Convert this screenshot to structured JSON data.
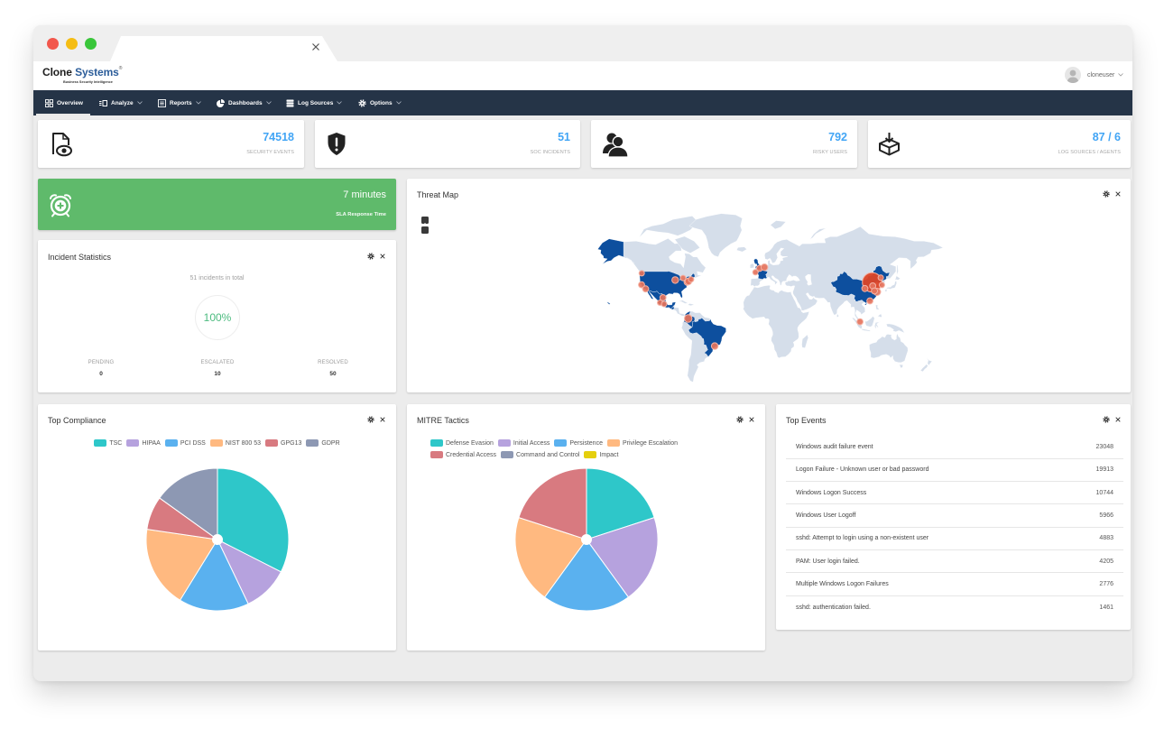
{
  "header": {
    "logo": {
      "part1": "Clone",
      "part2": "Systems",
      "registered": "®",
      "tagline": "Business Security Intelligence"
    },
    "user": {
      "name": "cloneuser"
    }
  },
  "nav": {
    "items": [
      {
        "label": "Overview",
        "icon": "grid-icon",
        "active": true,
        "dropdown": false
      },
      {
        "label": "Analyze",
        "icon": "analyze-icon",
        "active": false,
        "dropdown": true
      },
      {
        "label": "Reports",
        "icon": "report-icon",
        "active": false,
        "dropdown": true
      },
      {
        "label": "Dashboards",
        "icon": "pie-chart-icon",
        "active": false,
        "dropdown": true
      },
      {
        "label": "Log Sources",
        "icon": "database-icon",
        "active": false,
        "dropdown": true
      },
      {
        "label": "Options",
        "icon": "gear-icon",
        "active": false,
        "dropdown": true
      }
    ]
  },
  "stats": [
    {
      "value": "74518",
      "label": "SECURITY EVENTS",
      "icon": "document-eye-icon"
    },
    {
      "value": "51",
      "label": "SOC INCIDENTS",
      "icon": "shield-alert-icon"
    },
    {
      "value": "792",
      "label": "RISKY USERS",
      "icon": "users-icon"
    },
    {
      "value": "87 / 6",
      "label": "LOG SOURCES / AGENTS",
      "icon": "inbox-download-icon"
    }
  ],
  "sla": {
    "value": "7 minutes",
    "label": "SLA Response Time",
    "icon": "alarm-plus-icon"
  },
  "incident_statistics": {
    "title": "Incident Statistics",
    "summary": "51 incidents in total",
    "percent": "100%",
    "columns": [
      {
        "label": "PENDING",
        "value": "0"
      },
      {
        "label": "ESCALATED",
        "value": "10"
      },
      {
        "label": "RESOLVED",
        "value": "50"
      }
    ]
  },
  "threat_map": {
    "title": "Threat Map",
    "highlighted_regions": [
      "US",
      "MX",
      "GT",
      "CO",
      "BR",
      "GB",
      "FR",
      "CN"
    ],
    "markers": [
      {
        "lon": -122.3,
        "lat": 47.6,
        "weight": 1
      },
      {
        "lon": -122.4,
        "lat": 37.8,
        "weight": 1.3
      },
      {
        "lon": -118.2,
        "lat": 34.0,
        "weight": 1.3
      },
      {
        "lon": -87.6,
        "lat": 41.9,
        "weight": 1.5
      },
      {
        "lon": -79.4,
        "lat": 43.7,
        "weight": 1
      },
      {
        "lon": -75.2,
        "lat": 40.0,
        "weight": 1.3
      },
      {
        "lon": -73.9,
        "lat": 40.7,
        "weight": 1.5
      },
      {
        "lon": -71.1,
        "lat": 42.4,
        "weight": 1
      },
      {
        "lon": -100.3,
        "lat": 25.7,
        "weight": 1.3
      },
      {
        "lon": -103.3,
        "lat": 20.7,
        "weight": 1
      },
      {
        "lon": -99.1,
        "lat": 19.4,
        "weight": 1
      },
      {
        "lon": -74.1,
        "lat": 4.7,
        "weight": 2
      },
      {
        "lon": -46.6,
        "lat": -23.5,
        "weight": 1.5
      },
      {
        "lon": -0.1,
        "lat": 51.5,
        "weight": 1.3
      },
      {
        "lon": 4.9,
        "lat": 52.4,
        "weight": 1.5
      },
      {
        "lon": -4.5,
        "lat": 48.4,
        "weight": 1
      },
      {
        "lon": 116.4,
        "lat": 39.9,
        "weight": 13,
        "primary": true
      },
      {
        "lon": 125.3,
        "lat": 43.9,
        "weight": 1
      },
      {
        "lon": 126.6,
        "lat": 37.5,
        "weight": 1
      },
      {
        "lon": 108.9,
        "lat": 34.3,
        "weight": 1.3
      },
      {
        "lon": 117.0,
        "lat": 36.7,
        "weight": 1.3
      },
      {
        "lon": 121.5,
        "lat": 31.2,
        "weight": 1.8
      },
      {
        "lon": 118.8,
        "lat": 32.1,
        "weight": 1.3
      },
      {
        "lon": 114.1,
        "lat": 22.5,
        "weight": 1.3
      },
      {
        "lon": 103.8,
        "lat": 1.35,
        "weight": 1.3
      }
    ]
  },
  "top_events": {
    "title": "Top Events",
    "rows": [
      {
        "name": "Windows audit failure event",
        "count": "23048"
      },
      {
        "name": "Logon Failure - Unknown user or bad password",
        "count": "19913"
      },
      {
        "name": "Windows Logon Success",
        "count": "10744"
      },
      {
        "name": "Windows User Logoff",
        "count": "5966"
      },
      {
        "name": "sshd: Attempt to login using a non-existent user",
        "count": "4883"
      },
      {
        "name": "PAM: User login failed.",
        "count": "4205"
      },
      {
        "name": "Multiple Windows Logon Failures",
        "count": "2776"
      },
      {
        "name": "sshd: authentication failed.",
        "count": "1461"
      }
    ]
  },
  "colors": {
    "nav_bg": "#253447",
    "accent": "#42a5f5",
    "sla_green": "#5fba6b",
    "success": "#4cbb7f",
    "map_land": "#d5deea",
    "map_highlight": "#0d4f9e",
    "marker": "#e5735c",
    "marker_stroke": "#f4b3a5",
    "marker_primary": "#dc4527"
  },
  "chart_data": [
    {
      "type": "pie",
      "title": "Top Compliance",
      "categories": [
        "TSC",
        "HIPAA",
        "PCI DSS",
        "NIST 800 53",
        "GPG13",
        "GDPR"
      ],
      "values": [
        32.5,
        10.4,
        15.9,
        18.5,
        7.6,
        15.1
      ],
      "unit": "percent (estimated)",
      "colors": [
        "#2ec7c9",
        "#b6a2de",
        "#5ab1ef",
        "#ffb980",
        "#d87a80",
        "#8d98b3"
      ],
      "legend": "top-center"
    },
    {
      "type": "pie",
      "title": "MITRE Tactics",
      "categories": [
        "Defense Evasion",
        "Initial Access",
        "Persistence",
        "Privilege Escalation",
        "Credential Access",
        "Command and Control",
        "Impact"
      ],
      "values": [
        20,
        20,
        20,
        20,
        20,
        0,
        0
      ],
      "unit": "percent (estimated)",
      "colors": [
        "#2ec7c9",
        "#b6a2de",
        "#5ab1ef",
        "#ffb980",
        "#d87a80",
        "#8d98b3",
        "#e5cf0d"
      ],
      "legend": "top-center"
    }
  ]
}
